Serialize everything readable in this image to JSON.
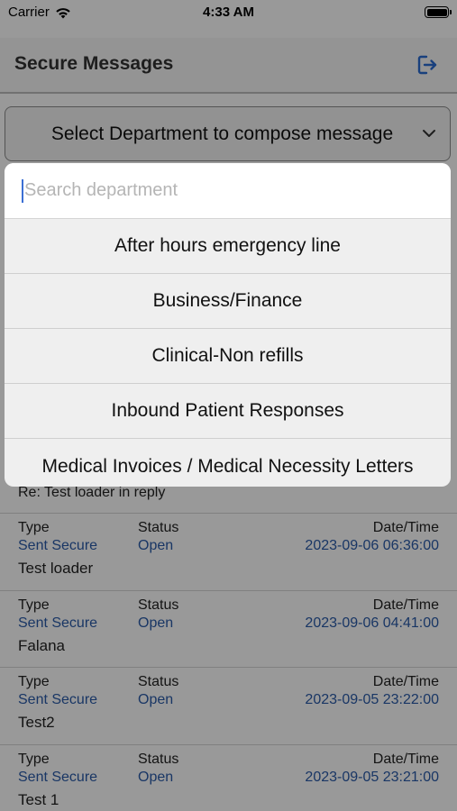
{
  "status_bar": {
    "carrier": "Carrier",
    "time": "4:33 AM"
  },
  "header": {
    "title": "Secure Messages",
    "logout_icon": "logout-icon",
    "accent_color": "#2a6bd1"
  },
  "compose": {
    "select_label": "Select Department to compose message",
    "chevron_icon": "chevron-down-icon"
  },
  "dropdown": {
    "search_placeholder": "Search department",
    "options": [
      "After hours emergency line",
      "Business/Finance",
      "Clinical-Non refills",
      "Inbound Patient Responses",
      "Medical Invoices / Medical Necessity Letters"
    ]
  },
  "messages": {
    "labels": {
      "type": "Type",
      "status": "Status",
      "datetime": "Date/Time"
    },
    "partial_subject": "Re: Test loader in reply",
    "items": [
      {
        "type": "Sent Secure",
        "status": "Open",
        "datetime": "2023-09-06 06:36:00",
        "subject": "Test loader"
      },
      {
        "type": "Sent Secure",
        "status": "Open",
        "datetime": "2023-09-06 04:41:00",
        "subject": "Falana"
      },
      {
        "type": "Sent Secure",
        "status": "Open",
        "datetime": "2023-09-05 23:22:00",
        "subject": "Test2"
      },
      {
        "type": "Sent Secure",
        "status": "Open",
        "datetime": "2023-09-05 23:21:00",
        "subject": "Test 1"
      }
    ]
  },
  "colors": {
    "link_blue": "#2a5ba8",
    "cursor_blue": "#3b6fd4",
    "overlay": "rgba(0,0,0,0.40)"
  }
}
